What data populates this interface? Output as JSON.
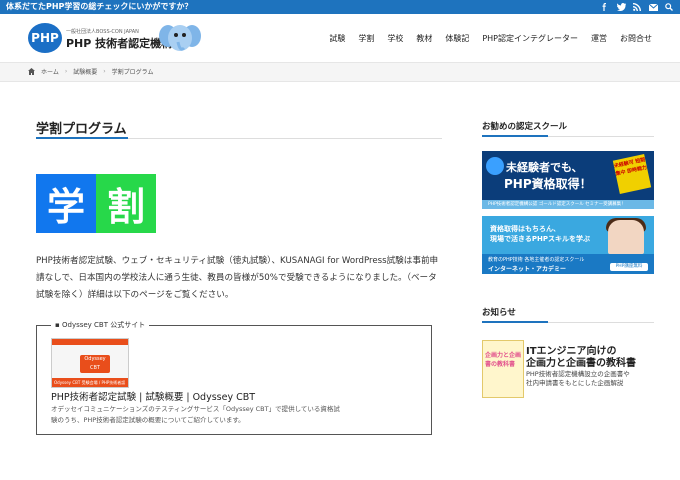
{
  "topbar": {
    "message": "体系だてたPHP学習の総チェックにいかがですか？",
    "icons": [
      "facebook-icon",
      "twitter-icon",
      "rss-icon",
      "mail-icon",
      "search-icon"
    ]
  },
  "header": {
    "logo_mark": "PHP",
    "logo_sub": "一般社団法人BOSS-CON JAPAN",
    "logo_name": "PHP 技術者認定機構",
    "nav": [
      "試験",
      "学割",
      "学校",
      "教材",
      "体験記",
      "PHP認定インテグレーター",
      "運営",
      "お問合せ"
    ]
  },
  "breadcrumb": {
    "home": "ホーム",
    "parent": "試験概要",
    "current": "学割プログラム"
  },
  "main": {
    "title": "学割プログラム",
    "hero_chars": [
      "学",
      "割"
    ],
    "paragraph": "PHP技術者認定試験、ウェブ・セキュリティ試験（徳丸試験）、KUSANAGI for WordPress試験は事前申請なしで、日本国内の学校法人に通う生徒、教員の皆様が50%で受験できるようになりました。（ベータ試験を除く）詳細は以下のページをご覧ください。",
    "card": {
      "label": "Odyssey CBT 公式サイト",
      "thumb_logo": "Odyssey CBT",
      "thumb_footer": "Odyssey CBT 受験会場 / PHP技術者認定試験",
      "title": "PHP技術者認定試験 | 試験概要 | Odyssey CBT",
      "description": "オデッセイコミュニケーションズのテスティングサービス「Odyssey CBT」で提供している資格試験のうち、PHP技術者認定試験の概要についてご紹介しています。"
    }
  },
  "sidebar": {
    "schools_heading": "お勧めの認定スクール",
    "banner1": {
      "line1": "未経験者でも、",
      "line2": "PHP資格取得！",
      "badge": "未経験可 短期集中 即時戦力",
      "footer": "PHP技術者認定機構公認 ゴールド認定スクール セミナー受講募集！"
    },
    "banner2": {
      "line1": "資格取得はもちろん、",
      "line2": "現場で活きるPHPスキルを学ぶ",
      "footer_line1": "教育のPHP技術 各地主催者の認定スクール",
      "footer_line2": "インターネット・アカデミー",
      "button": "PHP講座無料"
    },
    "news_heading": "お知らせ",
    "news": {
      "book_text": "企画力と企画書の教科書",
      "title_line1": "ITエンジニア向けの",
      "title_line2": "企画力と企画書の教科書",
      "desc_line1": "PHP技術者認定機構設立の企画書や",
      "desc_line2": "社内申請書をもとにした企画解説"
    }
  },
  "colors": {
    "accent": "#1e73be",
    "hero_blue": "#1177ee",
    "hero_green": "#27d84a"
  }
}
